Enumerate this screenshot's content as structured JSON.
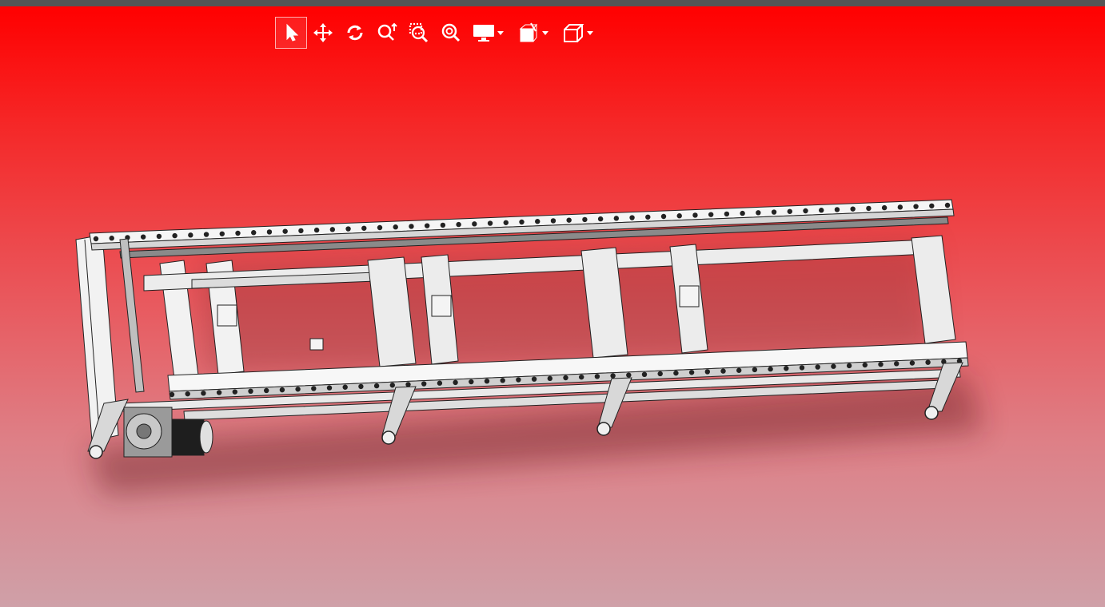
{
  "window": {
    "title": ""
  },
  "toolbar": {
    "tools": [
      {
        "name": "select",
        "icon": "cursor-icon",
        "active": true
      },
      {
        "name": "pan",
        "icon": "move-arrows-icon",
        "active": false
      },
      {
        "name": "rotate",
        "icon": "rotate-icon",
        "active": false
      },
      {
        "name": "zoom",
        "icon": "zoom-updown-icon",
        "active": false
      },
      {
        "name": "zoom-window",
        "icon": "zoom-window-icon",
        "active": false
      },
      {
        "name": "zoom-fit",
        "icon": "zoom-fit-icon",
        "active": false
      },
      {
        "name": "display-mode",
        "icon": "monitor-icon",
        "dropdown": true
      },
      {
        "name": "section-view",
        "icon": "section-box-icon",
        "dropdown": true
      },
      {
        "name": "view-orientation",
        "icon": "cube-icon",
        "dropdown": true
      }
    ]
  },
  "viewport": {
    "background_top": "#ff0000",
    "background_bottom": "#cfa0a8",
    "model": "roller-conveyor-assembly"
  }
}
